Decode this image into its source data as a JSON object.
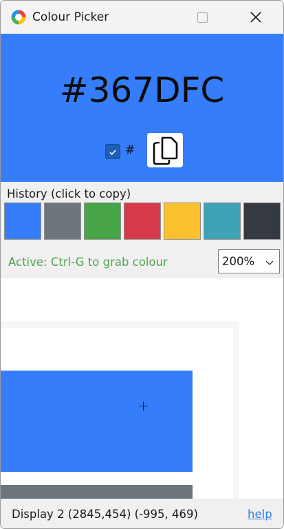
{
  "window": {
    "title": "Colour Picker"
  },
  "icons": {
    "app": "colour-picker-app-icon",
    "minimize": "minimize-icon",
    "maximize": "maximize-icon",
    "close": "close-icon",
    "check": "checkmark-icon",
    "copy": "copy-icon",
    "dropdown": "chevron-down-icon",
    "crosshair": "crosshair-icon"
  },
  "colour": {
    "hex": "#367DFC",
    "swatch": "#367dfc",
    "include_hash_checked": true,
    "include_hash_label": "#"
  },
  "history": {
    "label": "History (click to copy)",
    "swatches": [
      "#367dfc",
      "#6d757d",
      "#47a547",
      "#d63a4a",
      "#fbc02d",
      "#3fa3b6",
      "#343a40"
    ]
  },
  "grab": {
    "status": "Active: Ctrl-G to grab colour",
    "status_color": "#4ca64c"
  },
  "zoom": {
    "selected": "200%"
  },
  "preview_colors": {
    "main": "#367dfc",
    "secondary": "#6d757d"
  },
  "status_bar": {
    "display_info": "Display 2 (2845,454) (-995, 469)",
    "help_label": "help"
  }
}
